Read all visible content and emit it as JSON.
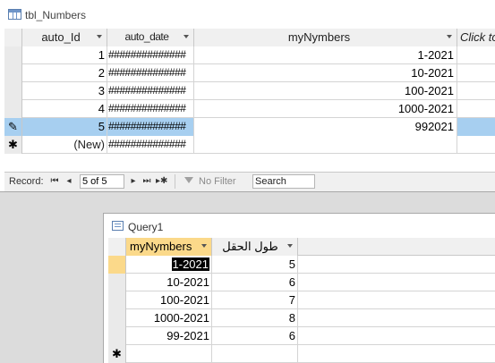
{
  "table_window": {
    "title": "tbl_Numbers",
    "icon": "table-icon",
    "columns": [
      "auto_Id",
      "auto_date",
      "myNymbers",
      "Click to Add"
    ],
    "rows": [
      {
        "selector": "",
        "auto_id": "1",
        "auto_date": "##############",
        "mynymbers": "1-2021"
      },
      {
        "selector": "",
        "auto_id": "2",
        "auto_date": "##############",
        "mynymbers": "10-2021"
      },
      {
        "selector": "",
        "auto_id": "3",
        "auto_date": "##############",
        "mynymbers": "100-2021"
      },
      {
        "selector": "",
        "auto_id": "4",
        "auto_date": "##############",
        "mynymbers": "1000-2021"
      },
      {
        "selector": "✎",
        "auto_id": "5",
        "auto_date": "##############",
        "mynymbers": "992021"
      },
      {
        "selector": "✱",
        "auto_id": "(New)",
        "auto_date": "##############",
        "mynymbers": ""
      }
    ],
    "selected_row": 4,
    "navigation": {
      "record_label": "Record:",
      "position": "5 of 5",
      "no_filter_label": "No Filter",
      "search_placeholder": "Search"
    }
  },
  "query_window": {
    "title": "Query1",
    "icon": "query-icon",
    "columns": [
      "myNymbers",
      "طول الحقل"
    ],
    "rows": [
      {
        "mynymbers": "1-2021",
        "length": "5"
      },
      {
        "mynymbers": "10-2021",
        "length": "6"
      },
      {
        "mynymbers": "100-2021",
        "length": "7"
      },
      {
        "mynymbers": "1000-2021",
        "length": "8"
      },
      {
        "mynymbers": "99-2021",
        "length": "6"
      }
    ],
    "new_row_marker": "✱",
    "colors": {
      "active_header": "#fbd98a",
      "selected_row": "#a7cff0"
    }
  }
}
